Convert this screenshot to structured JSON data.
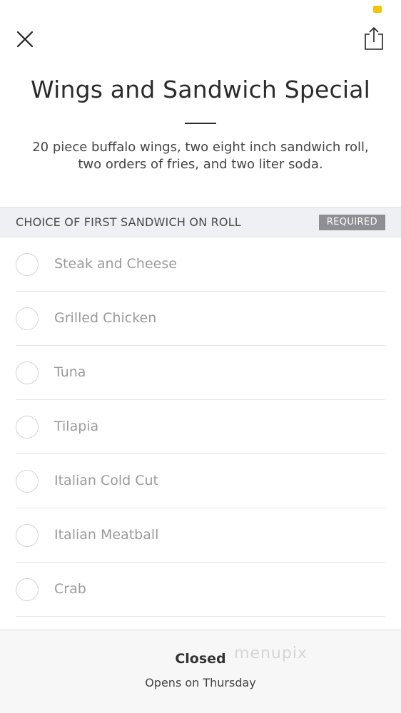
{
  "header": {
    "close_icon": "close-icon",
    "share_icon": "share-icon"
  },
  "item": {
    "title": "Wings and Sandwich Special",
    "description": "20 piece buffalo wings, two eight inch sandwich roll, two orders of fries, and two liter soda."
  },
  "section": {
    "title": "CHOICE OF FIRST SANDWICH ON ROLL",
    "badge": "REQUIRED",
    "options": [
      {
        "label": "Steak and Cheese"
      },
      {
        "label": "Grilled Chicken"
      },
      {
        "label": "Tuna"
      },
      {
        "label": "Tilapia"
      },
      {
        "label": "Italian Cold Cut"
      },
      {
        "label": "Italian Meatball"
      },
      {
        "label": "Crab"
      }
    ]
  },
  "footer": {
    "status": "Closed",
    "subtext": "Opens on Thursday",
    "watermark": "menupix"
  },
  "colors": {
    "status_dot": "#f5c400",
    "badge_bg": "#8e8e93",
    "section_bg": "#eef0f4"
  }
}
